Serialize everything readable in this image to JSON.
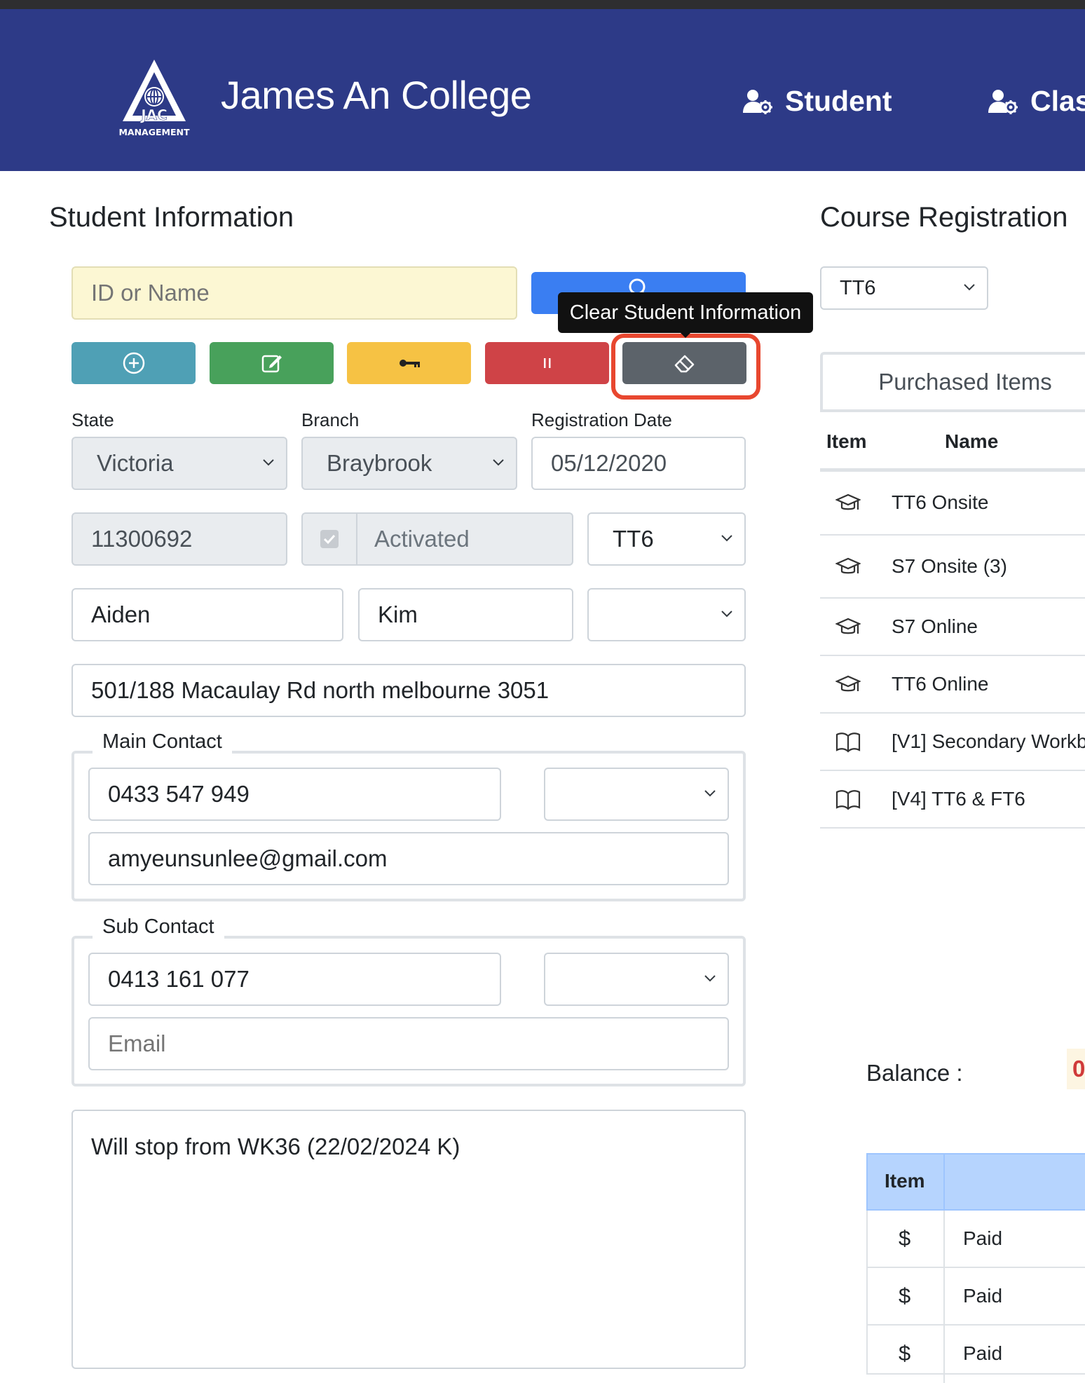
{
  "header": {
    "logo_text": "JAC",
    "logo_subtext": "MANAGEMENT",
    "college_name": "James An College",
    "nav": [
      {
        "label": "Student"
      },
      {
        "label": "Clas"
      }
    ]
  },
  "student_info": {
    "title": "Student Information",
    "search_placeholder": "ID or Name",
    "tooltip": "Clear Student Information",
    "labels": {
      "state": "State",
      "branch": "Branch",
      "registration_date": "Registration Date"
    },
    "state": "Victoria",
    "branch": "Braybrook",
    "registration_date": "05/12/2020",
    "student_id": "11300692",
    "status": "Activated",
    "status_checked": true,
    "level": "TT6",
    "first_name": "Aiden",
    "last_name": "Kim",
    "gender": "",
    "address": "501/188 Macaulay Rd north melbourne 3051",
    "main_contact": {
      "legend": "Main Contact",
      "phone": "0433 547 949",
      "relation": "",
      "email": "amyeunsunlee@gmail.com"
    },
    "sub_contact": {
      "legend": "Sub Contact",
      "phone": "0413 161 077",
      "relation": "",
      "email_placeholder": "Email"
    },
    "notes": "Will stop from WK36 (22/02/2024 K)"
  },
  "course_registration": {
    "title": "Course Registration",
    "course_select": "TT6",
    "purchased_items_title": "Purchased Items",
    "columns": {
      "item": "Item",
      "name": "Name"
    },
    "items": [
      {
        "icon": "graduation-cap-icon",
        "name": "TT6 Onsite"
      },
      {
        "icon": "graduation-cap-icon",
        "name": "S7 Onsite (3)"
      },
      {
        "icon": "graduation-cap-icon",
        "name": "S7 Online"
      },
      {
        "icon": "graduation-cap-icon",
        "name": "TT6 Online"
      },
      {
        "icon": "book-icon",
        "name": "[V1] Secondary Workb"
      },
      {
        "icon": "book-icon",
        "name": "[V4] TT6 & FT6"
      }
    ],
    "balance_label": "Balance :",
    "balance_value": "0",
    "payments_header": {
      "item": "Item"
    },
    "payments": [
      {
        "symbol": "$",
        "status": "Paid"
      },
      {
        "symbol": "$",
        "status": "Paid"
      },
      {
        "symbol": "$",
        "status": "Paid"
      }
    ]
  },
  "colors": {
    "header_bg": "#2d3a87",
    "search_bg": "#fcf7d3",
    "btn_add": "#4fa0b5",
    "btn_edit": "#48a15b",
    "btn_key": "#f6c244",
    "btn_pause": "#cf4347",
    "btn_clear": "#5c636a",
    "btn_search": "#3a7ef2",
    "highlight": "#e8472f"
  }
}
